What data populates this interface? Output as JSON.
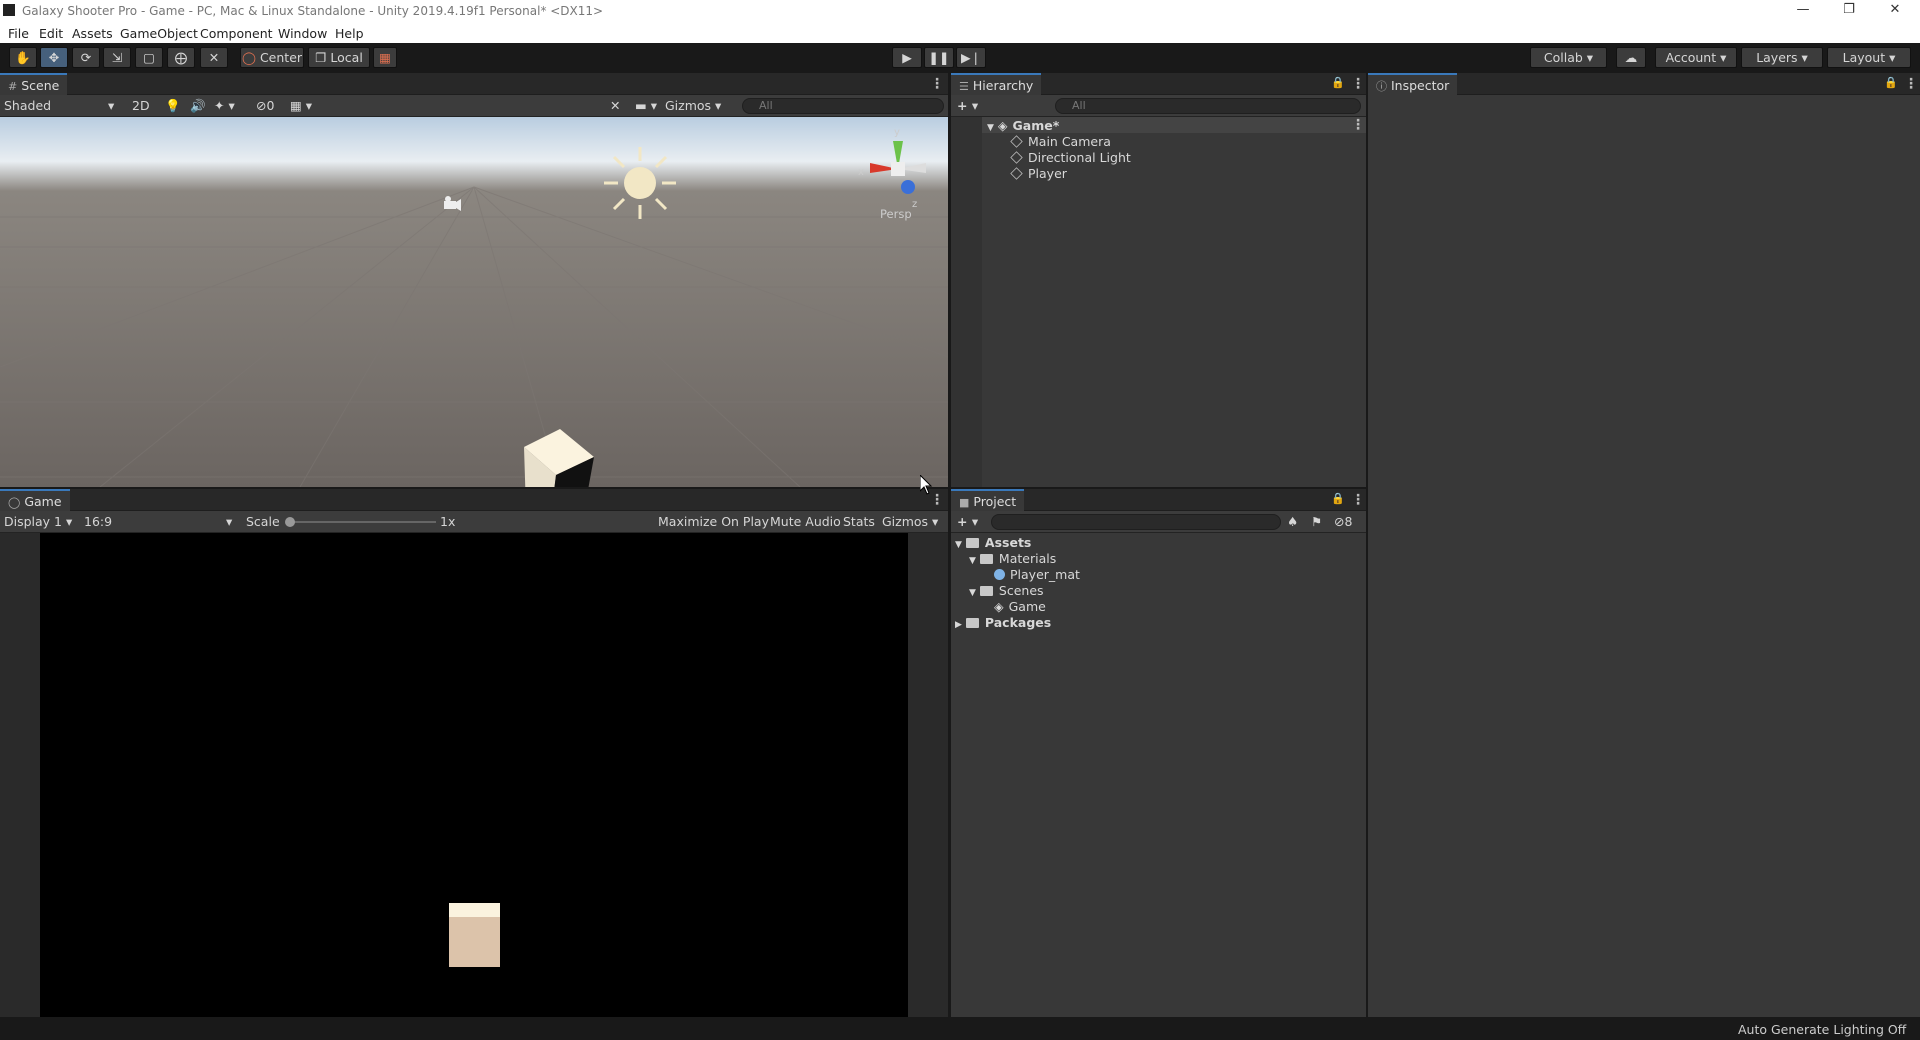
{
  "window": {
    "title": "Galaxy Shooter Pro - Game - PC, Mac & Linux Standalone - Unity 2019.4.19f1 Personal* <DX11>"
  },
  "menu": [
    "File",
    "Edit",
    "Assets",
    "GameObject",
    "Component",
    "Window",
    "Help"
  ],
  "toolbar": {
    "pivot": "Center",
    "space": "Local",
    "collab": "Collab",
    "account": "Account",
    "layers": "Layers",
    "layout": "Layout"
  },
  "scene": {
    "tab": "Scene",
    "shading": "Shaded",
    "mode2d": "2D",
    "hidden_count": "0",
    "gizmos": "Gizmos",
    "search_placeholder": "All",
    "persp": "Persp",
    "axes": {
      "x": "x",
      "y": "y",
      "z": "z"
    }
  },
  "game": {
    "tab": "Game",
    "display": "Display 1",
    "aspect": "16:9",
    "scale_label": "Scale",
    "scale_value": "1x",
    "maximize": "Maximize On Play",
    "mute": "Mute Audio",
    "stats": "Stats",
    "gizmos": "Gizmos"
  },
  "hierarchy": {
    "tab": "Hierarchy",
    "search_placeholder": "All",
    "root": "Game*",
    "items": [
      "Main Camera",
      "Directional Light",
      "Player"
    ]
  },
  "inspector": {
    "tab": "Inspector"
  },
  "project": {
    "tab": "Project",
    "hidden_count": "8",
    "tree": {
      "assets": "Assets",
      "materials": "Materials",
      "material_item": "Player_mat",
      "scenes": "Scenes",
      "scene_item": "Game",
      "packages": "Packages"
    }
  },
  "status": {
    "text": "Auto Generate Lighting Off"
  },
  "colors": {
    "accent": "#3a79bb",
    "cube": "#fbf3df",
    "sun": "#f2e7c5"
  }
}
